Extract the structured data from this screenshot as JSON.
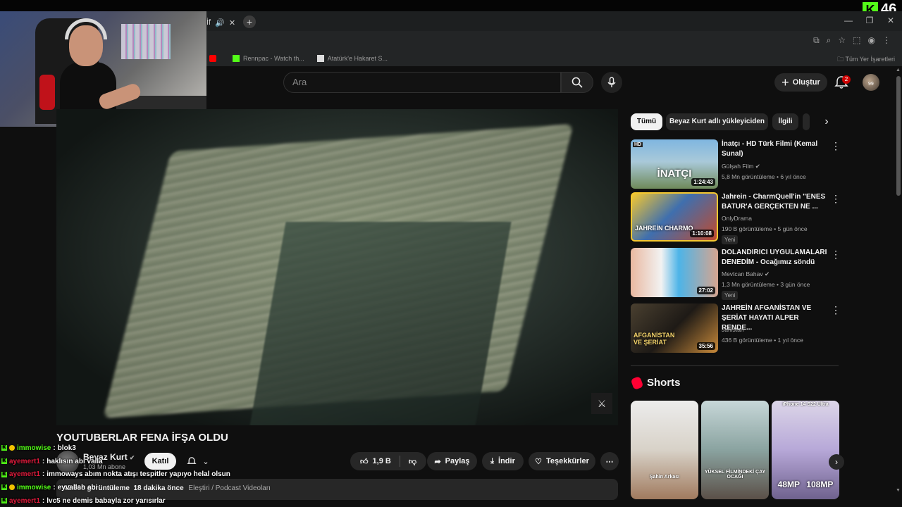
{
  "browser": {
    "tab_active_label": "İf",
    "new_tab_label": "+",
    "bookmarks": [
      {
        "label": "",
        "icon": "youtube-icon",
        "color": "#ff0000"
      },
      {
        "label": "Rennpac - Watch th...",
        "icon": "kick-icon",
        "color": "#53fc18"
      },
      {
        "label": "Atatürk'e Hakaret S...",
        "icon": "page-icon",
        "color": "#dddddd"
      }
    ],
    "bookmarks_folder": "Tüm Yer İşaretleri"
  },
  "overlay": {
    "kick_viewers": "46",
    "kick_color": "#53fc18"
  },
  "youtube": {
    "search_placeholder": "Ara",
    "create_label": "Oluştur",
    "notification_count": "2",
    "avatar_badge": "99"
  },
  "video": {
    "title": "YOUTUBERLAR FENA İFŞA OLDU",
    "channel": "Beyaz Kurt",
    "subscribers": "1,03 Mn abone",
    "join_label": "Katıl",
    "likes": "1,9 B",
    "share_label": "Paylaş",
    "download_label": "İndir",
    "thanks_label": "Teşekkürler",
    "views": "42.596 görüntüleme",
    "time_ago": "18 dakika önce",
    "category": "Eleştiri / Podcast Videoları"
  },
  "chat": [
    {
      "user": "immowise",
      "color": "u-green",
      "badge": true,
      "message": "blok3"
    },
    {
      "user": "ayemert1",
      "color": "u-red",
      "badge": false,
      "message": "haklısın abi valla"
    },
    {
      "user": "ayemert1",
      "color": "u-red",
      "badge": false,
      "message": "immoways abım nokta atışı tespitler yapıyo helal olsun"
    },
    {
      "user": "immowise",
      "color": "u-green",
      "badge": true,
      "message": "eyvallah abi"
    },
    {
      "user": "ayemert1",
      "color": "u-red",
      "badge": false,
      "message": "lvc5 ne demis babayla zor yarısırlar"
    }
  ],
  "filters": {
    "all": "Tümü",
    "uploader": "Beyaz Kurt adlı yükleyiciden",
    "related": "İlgili"
  },
  "recommendations": [
    {
      "title": "İnatçı - HD Türk Filmi (Kemal Sunal)",
      "channel": "Gülşah Film",
      "verified": true,
      "views": "5,8 Mn görüntüleme",
      "age": "6 yıl önce",
      "duration": "1:24:43",
      "is_new": false,
      "new_label": ""
    },
    {
      "title": "Jahrein - CharmQuell'in \"ENES BATUR'A GERÇEKTEN NE ...",
      "channel": "OnlyDrama",
      "verified": false,
      "views": "190 B görüntüleme",
      "age": "5 gün önce",
      "duration": "1:10:08",
      "is_new": true,
      "new_label": "Yeni"
    },
    {
      "title": "DOLANDIRICI UYGULAMALARI DENEDİM - Ocağımız söndü",
      "channel": "Mevtcan Bahav",
      "verified": true,
      "views": "1,3 Mn görüntüleme",
      "age": "3 gün önce",
      "duration": "27:02",
      "is_new": true,
      "new_label": "Yeni"
    },
    {
      "title": "JAHREİN AFGANİSTAN VE ŞERİAT HAYATI ALPER RENDE...",
      "channel": "Jahistan",
      "verified": false,
      "views": "436 B görüntüleme",
      "age": "1 yıl önce",
      "duration": "35:56",
      "is_new": false,
      "new_label": ""
    }
  ],
  "thumb_texts": [
    "İNATÇI",
    "JAHREİN CHARMQ",
    "",
    "AFGANİSTAN VE ŞERİAT"
  ],
  "shorts": {
    "title": "Shorts",
    "items": [
      {
        "caption": "Şahin Arkası",
        "big_left": "",
        "big_right": ""
      },
      {
        "caption": "YÜKSEL FİLMİNDEKİ ÇAY OCAĞI",
        "big_left": "",
        "big_right": ""
      },
      {
        "caption": "iPhone 14 S22 Ultra",
        "big_left": "48MP",
        "big_right": "108MP"
      }
    ]
  }
}
